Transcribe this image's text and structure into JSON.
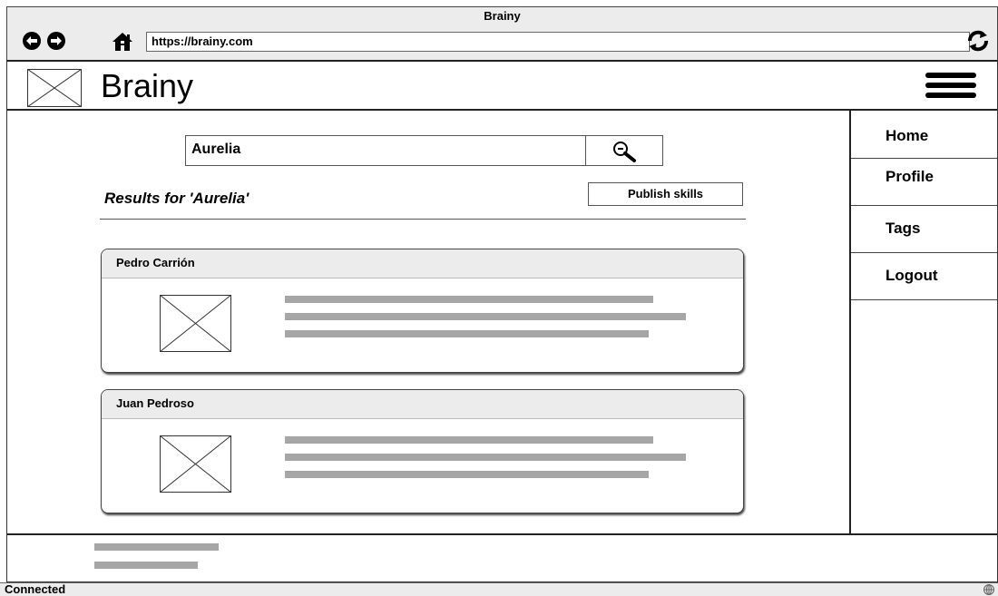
{
  "window": {
    "title": "Brainy",
    "url": "https://brainy.com"
  },
  "header": {
    "brand": "Brainy"
  },
  "search": {
    "value": "Aurelia"
  },
  "results": {
    "title": "Results for 'Aurelia'",
    "publish_label": "Publish skills",
    "cards": [
      {
        "name": "Pedro Carrión"
      },
      {
        "name": "Juan Pedroso"
      }
    ]
  },
  "sidebar": {
    "items": [
      {
        "label": "Home"
      },
      {
        "label": "Profile"
      },
      {
        "label": "Tags"
      },
      {
        "label": "Logout"
      }
    ]
  },
  "status": {
    "text": "Connected"
  }
}
